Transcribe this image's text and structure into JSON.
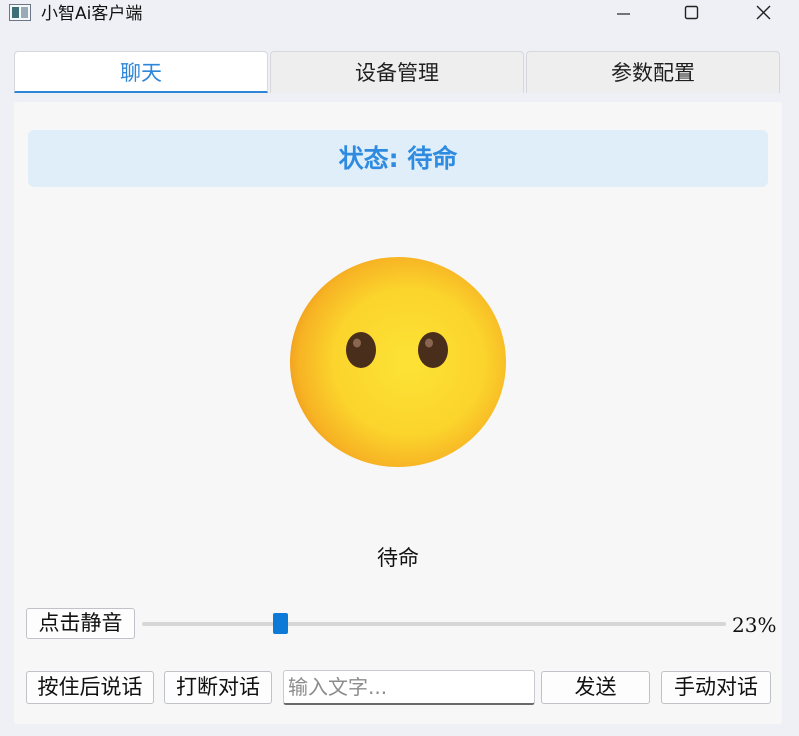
{
  "window": {
    "title": "小智Ai客户端",
    "controls": {
      "minimize": "minimize-icon",
      "maximize": "maximize-icon",
      "close": "close-icon"
    }
  },
  "tabs": [
    {
      "label": "聊天",
      "active": true
    },
    {
      "label": "设备管理",
      "active": false
    },
    {
      "label": "参数配置",
      "active": false
    }
  ],
  "chat": {
    "status_text": "状态: 待命",
    "emotion_icon": "neutral-face-emoji",
    "emotion_label": "待命",
    "mute_button": "点击静音",
    "volume": {
      "value": 23,
      "label": "23%"
    },
    "hold_to_talk_button": "按住后说话",
    "interrupt_button": "打断对话",
    "text_input": {
      "placeholder": "输入文字...",
      "value": ""
    },
    "send_button": "发送",
    "manual_mode_button": "手动对话"
  },
  "colors": {
    "accent": "#2f86d8",
    "status_background": "#e0eefa",
    "slider_handle": "#0e7ad8"
  }
}
